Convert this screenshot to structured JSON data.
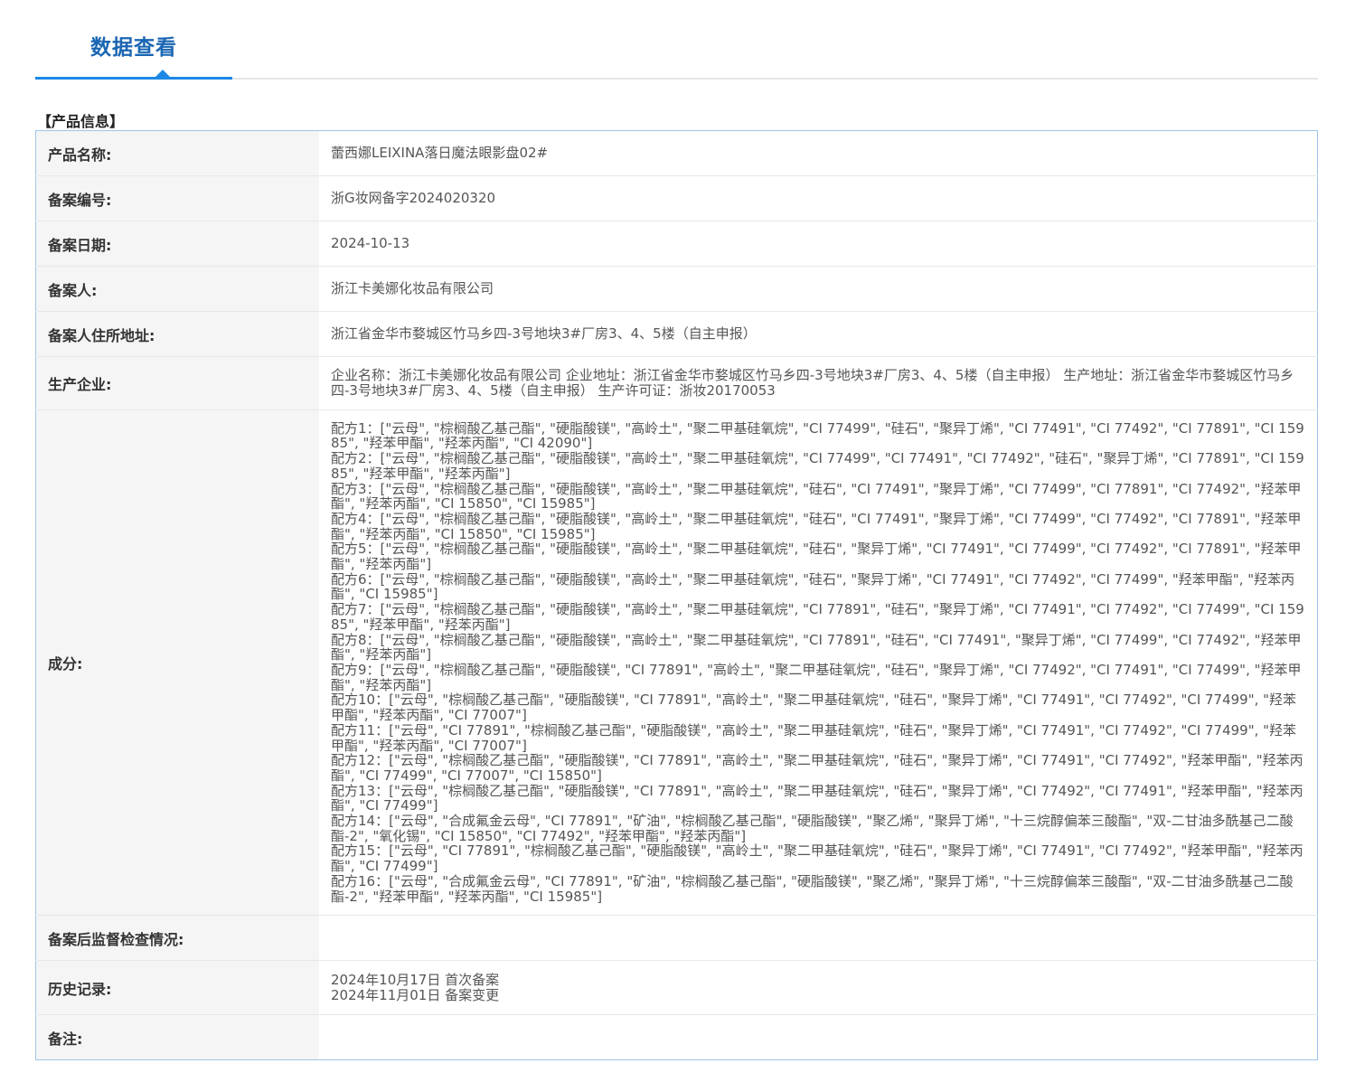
{
  "tab": {
    "title": "数据查看"
  },
  "section": {
    "heading": "【产品信息】"
  },
  "fields": {
    "product_name": {
      "label": "产品名称:",
      "value": "蕾西娜LEIXINA落日魔法眼影盘02#"
    },
    "filing_number": {
      "label": "备案编号:",
      "value": "浙G妆网备字2024020320"
    },
    "filing_date": {
      "label": "备案日期:",
      "value": "2024-10-13"
    },
    "filer": {
      "label": "备案人:",
      "value": "浙江卡美娜化妆品有限公司"
    },
    "filer_address": {
      "label": "备案人住所地址:",
      "value": "浙江省金华市婺城区竹马乡四-3号地块3#厂房3、4、5楼（自主申报）"
    },
    "manufacturer": {
      "label": "生产企业:",
      "value": "企业名称：浙江卡美娜化妆品有限公司 企业地址：浙江省金华市婺城区竹马乡四-3号地块3#厂房3、4、5楼（自主申报） 生产地址：浙江省金华市婺城区竹马乡四-3号地块3#厂房3、4、5楼（自主申报） 生产许可证：浙妆20170053"
    },
    "ingredients": {
      "label": "成分:"
    },
    "post_inspection": {
      "label": "备案后监督检查情况:",
      "value": ""
    },
    "history": {
      "label": "历史记录:"
    },
    "remarks": {
      "label": "备注:",
      "value": ""
    }
  },
  "formulas": [
    "配方1：[\"云母\", \"棕榈酸乙基己酯\", \"硬脂酸镁\", \"高岭土\", \"聚二甲基硅氧烷\", \"CI 77499\", \"硅石\", \"聚异丁烯\", \"CI 77491\", \"CI 77492\", \"CI 77891\", \"CI 15985\", \"羟苯甲酯\", \"羟苯丙酯\", \"CI 42090\"]",
    "配方2：[\"云母\", \"棕榈酸乙基己酯\", \"硬脂酸镁\", \"高岭土\", \"聚二甲基硅氧烷\", \"CI 77499\", \"CI 77491\", \"CI 77492\", \"硅石\", \"聚异丁烯\", \"CI 77891\", \"CI 15985\", \"羟苯甲酯\", \"羟苯丙酯\"]",
    "配方3：[\"云母\", \"棕榈酸乙基己酯\", \"硬脂酸镁\", \"高岭土\", \"聚二甲基硅氧烷\", \"硅石\", \"CI 77491\", \"聚异丁烯\", \"CI 77499\", \"CI 77891\", \"CI 77492\", \"羟苯甲酯\", \"羟苯丙酯\", \"CI 15850\", \"CI 15985\"]",
    "配方4：[\"云母\", \"棕榈酸乙基己酯\", \"硬脂酸镁\", \"高岭土\", \"聚二甲基硅氧烷\", \"硅石\", \"CI 77491\", \"聚异丁烯\", \"CI 77499\", \"CI 77492\", \"CI 77891\", \"羟苯甲酯\", \"羟苯丙酯\", \"CI 15850\", \"CI 15985\"]",
    "配方5：[\"云母\", \"棕榈酸乙基己酯\", \"硬脂酸镁\", \"高岭土\", \"聚二甲基硅氧烷\", \"硅石\", \"聚异丁烯\", \"CI 77491\", \"CI 77499\", \"CI 77492\", \"CI 77891\", \"羟苯甲酯\", \"羟苯丙酯\"]",
    "配方6：[\"云母\", \"棕榈酸乙基己酯\", \"硬脂酸镁\", \"高岭土\", \"聚二甲基硅氧烷\", \"硅石\", \"聚异丁烯\", \"CI 77491\", \"CI 77492\", \"CI 77499\", \"羟苯甲酯\", \"羟苯丙酯\", \"CI 15985\"]",
    "配方7：[\"云母\", \"棕榈酸乙基己酯\", \"硬脂酸镁\", \"高岭土\", \"聚二甲基硅氧烷\", \"CI 77891\", \"硅石\", \"聚异丁烯\", \"CI 77491\", \"CI 77492\", \"CI 77499\", \"CI 15985\", \"羟苯甲酯\", \"羟苯丙酯\"]",
    "配方8：[\"云母\", \"棕榈酸乙基己酯\", \"硬脂酸镁\", \"高岭土\", \"聚二甲基硅氧烷\", \"CI 77891\", \"硅石\", \"CI 77491\", \"聚异丁烯\", \"CI 77499\", \"CI 77492\", \"羟苯甲酯\", \"羟苯丙酯\"]",
    "配方9：[\"云母\", \"棕榈酸乙基己酯\", \"硬脂酸镁\", \"CI 77891\", \"高岭土\", \"聚二甲基硅氧烷\", \"硅石\", \"聚异丁烯\", \"CI 77492\", \"CI 77491\", \"CI 77499\", \"羟苯甲酯\", \"羟苯丙酯\"]",
    "配方10：[\"云母\", \"棕榈酸乙基己酯\", \"硬脂酸镁\", \"CI 77891\", \"高岭土\", \"聚二甲基硅氧烷\", \"硅石\", \"聚异丁烯\", \"CI 77491\", \"CI 77492\", \"CI 77499\", \"羟苯甲酯\", \"羟苯丙酯\", \"CI 77007\"]",
    "配方11：[\"云母\", \"CI 77891\", \"棕榈酸乙基己酯\", \"硬脂酸镁\", \"高岭土\", \"聚二甲基硅氧烷\", \"硅石\", \"聚异丁烯\", \"CI 77491\", \"CI 77492\", \"CI 77499\", \"羟苯甲酯\", \"羟苯丙酯\", \"CI 77007\"]",
    "配方12：[\"云母\", \"棕榈酸乙基己酯\", \"硬脂酸镁\", \"CI 77891\", \"高岭土\", \"聚二甲基硅氧烷\", \"硅石\", \"聚异丁烯\", \"CI 77491\", \"CI 77492\", \"羟苯甲酯\", \"羟苯丙酯\", \"CI 77499\", \"CI 77007\", \"CI 15850\"]",
    "配方13：[\"云母\", \"棕榈酸乙基己酯\", \"硬脂酸镁\", \"CI 77891\", \"高岭土\", \"聚二甲基硅氧烷\", \"硅石\", \"聚异丁烯\", \"CI 77492\", \"CI 77491\", \"羟苯甲酯\", \"羟苯丙酯\", \"CI 77499\"]",
    "配方14：[\"云母\", \"合成氟金云母\", \"CI 77891\", \"矿油\", \"棕榈酸乙基己酯\", \"硬脂酸镁\", \"聚乙烯\", \"聚异丁烯\", \"十三烷醇偏苯三酸酯\", \"双-二甘油多酰基己二酸酯-2\", \"氧化锡\", \"CI 15850\", \"CI 77492\", \"羟苯甲酯\", \"羟苯丙酯\"]",
    "配方15：[\"云母\", \"CI 77891\", \"棕榈酸乙基己酯\", \"硬脂酸镁\", \"高岭土\", \"聚二甲基硅氧烷\", \"硅石\", \"聚异丁烯\", \"CI 77491\", \"CI 77492\", \"羟苯甲酯\", \"羟苯丙酯\", \"CI 77499\"]",
    "配方16：[\"云母\", \"合成氟金云母\", \"CI 77891\", \"矿油\", \"棕榈酸乙基己酯\", \"硬脂酸镁\", \"聚乙烯\", \"聚异丁烯\", \"十三烷醇偏苯三酸酯\", \"双-二甘油多酰基己二酸酯-2\", \"羟苯甲酯\", \"羟苯丙酯\", \"CI 15985\"]"
  ],
  "history": [
    "2024年10月17日 首次备案",
    "2024年11月01日 备案变更"
  ],
  "colors": {
    "accent": "#1e88e5",
    "title": "#1a66b3",
    "table_border": "#9ec5ea",
    "label_bg": "#f5f5f5"
  }
}
